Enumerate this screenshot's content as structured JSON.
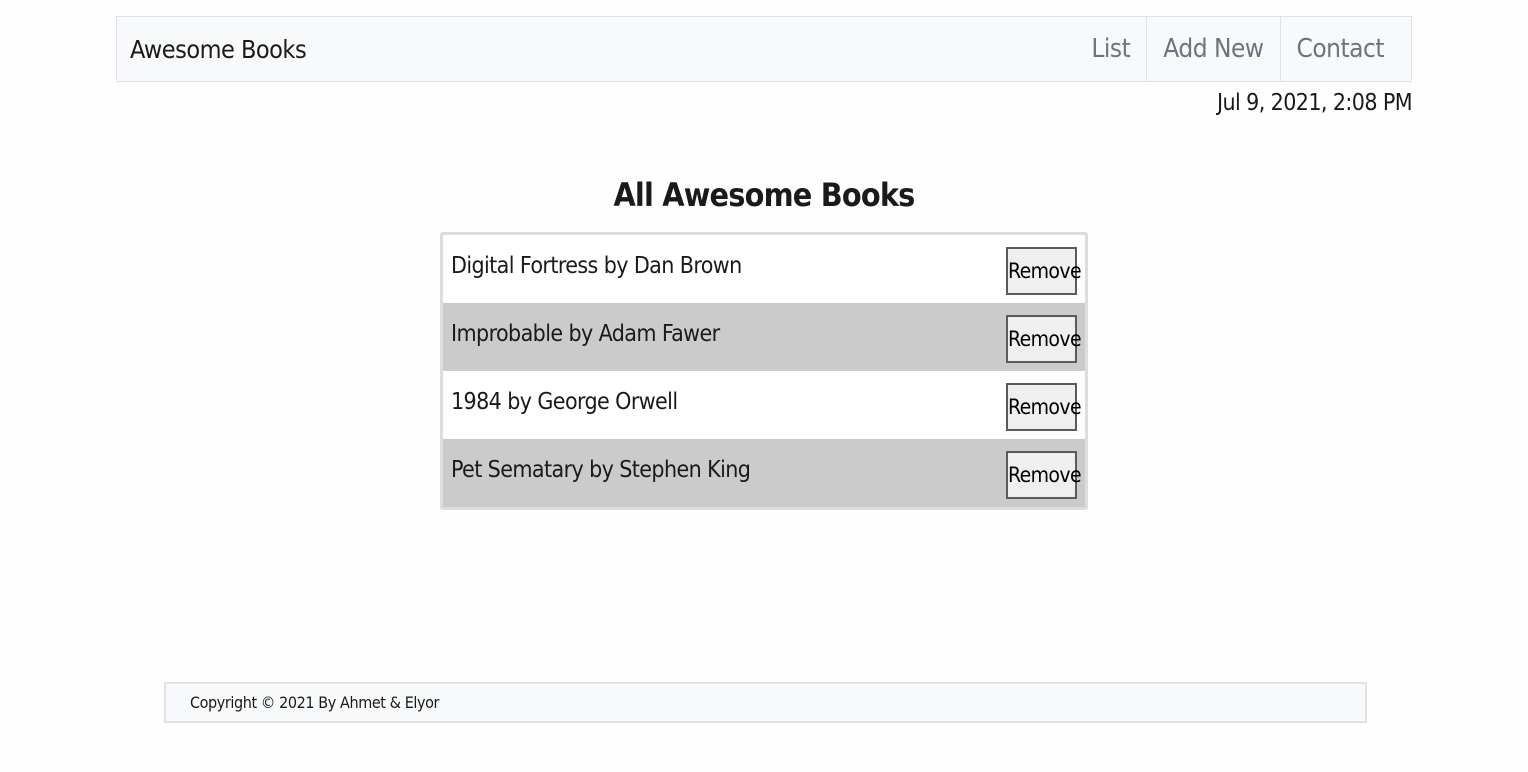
{
  "nav": {
    "brand": "Awesome Books",
    "links": [
      "List",
      "Add New",
      "Contact"
    ]
  },
  "date": "Jul 9, 2021, 2:08 PM",
  "main": {
    "title": "All Awesome Books",
    "books": [
      {
        "text": "Digital Fortress by Dan Brown",
        "button": "Remove"
      },
      {
        "text": "Improbable by Adam Fawer",
        "button": "Remove"
      },
      {
        "text": "1984 by George Orwell",
        "button": "Remove"
      },
      {
        "text": "Pet Sematary by Stephen King",
        "button": "Remove"
      }
    ]
  },
  "footer": {
    "text": "Copyright © 2021 By Ahmet & Elyor"
  },
  "colors": {
    "navbar_bg": "#f8f9fa",
    "row_alt_bg": "#cbcbcb",
    "border": "#dee2e6"
  }
}
